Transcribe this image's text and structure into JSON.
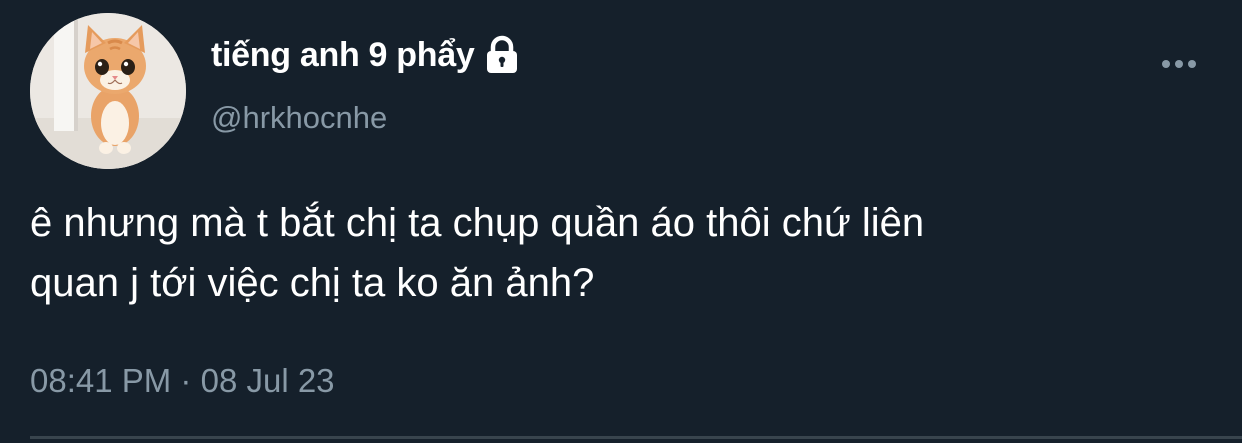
{
  "user": {
    "display_name": "tiếng anh 9 phẩy",
    "handle": "@hrkhocnhe",
    "protected_icon": "lock-icon",
    "avatar": "cat-photo-avatar"
  },
  "tweet": {
    "text_line_1": "ê nhưng mà t bắt chị ta chụp quần áo thôi chứ liên",
    "text_line_2": "quan j tới việc chị ta ko ăn ảnh?",
    "time": "08:41 PM",
    "separator": "·",
    "date": "08 Jul 23"
  },
  "actions": {
    "more_icon": "more-horizontal-icon"
  },
  "colors": {
    "background": "#15202b",
    "primary_text": "#ffffff",
    "secondary_text": "#8899a6",
    "divider": "#38444d"
  }
}
